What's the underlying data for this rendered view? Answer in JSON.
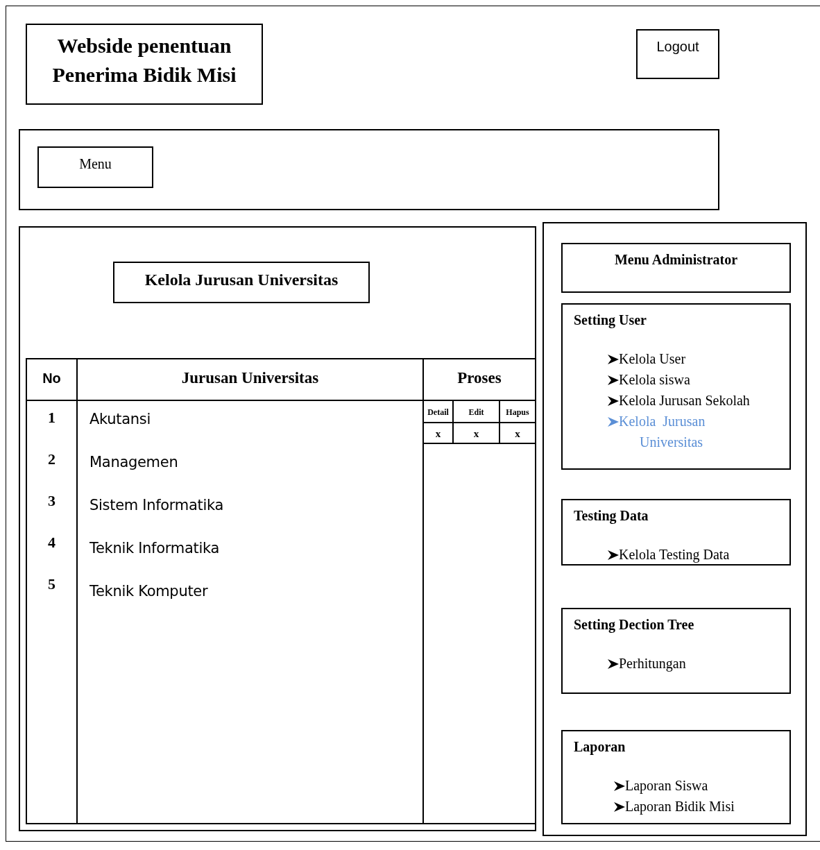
{
  "header": {
    "title": "Webside penentuan Penerima Bidik Misi",
    "logout": "Logout"
  },
  "menu_bar": {
    "button": "Menu"
  },
  "content": {
    "heading": "Kelola Jurusan Universitas",
    "table": {
      "columns": [
        "No",
        "Jurusan Universitas",
        "Proses"
      ],
      "actions": [
        "Detail",
        "Edit",
        "Hapus"
      ],
      "action_marks": [
        "x",
        "x",
        "x"
      ],
      "rows": [
        {
          "no": "1",
          "name": "Akutansi"
        },
        {
          "no": "2",
          "name": "Managemen"
        },
        {
          "no": "3",
          "name": "Sistem Informatika"
        },
        {
          "no": "4",
          "name": "Teknik Informatika"
        },
        {
          "no": "5",
          "name": "Teknik Komputer"
        }
      ]
    }
  },
  "sidebar": {
    "heading": "Menu Administrator",
    "sections": [
      {
        "title": "Setting User",
        "items": [
          {
            "label": "Kelola User",
            "selected": false
          },
          {
            "label": "Kelola siswa",
            "selected": false
          },
          {
            "label": "Kelola Jurusan Sekolah",
            "selected": false
          },
          {
            "label": "Kelola  Jurusan Universitas",
            "selected": true
          }
        ]
      },
      {
        "title": "Testing Data",
        "items": [
          {
            "label": "Kelola Testing Data",
            "selected": false
          }
        ]
      },
      {
        "title": "Setting Dection Tree",
        "items": [
          {
            "label": "Perhitungan",
            "selected": false
          }
        ]
      },
      {
        "title": "Laporan",
        "items": [
          {
            "label": "Laporan Siswa",
            "selected": false
          },
          {
            "label": "Laporan Bidik Misi",
            "selected": false
          }
        ]
      }
    ]
  }
}
